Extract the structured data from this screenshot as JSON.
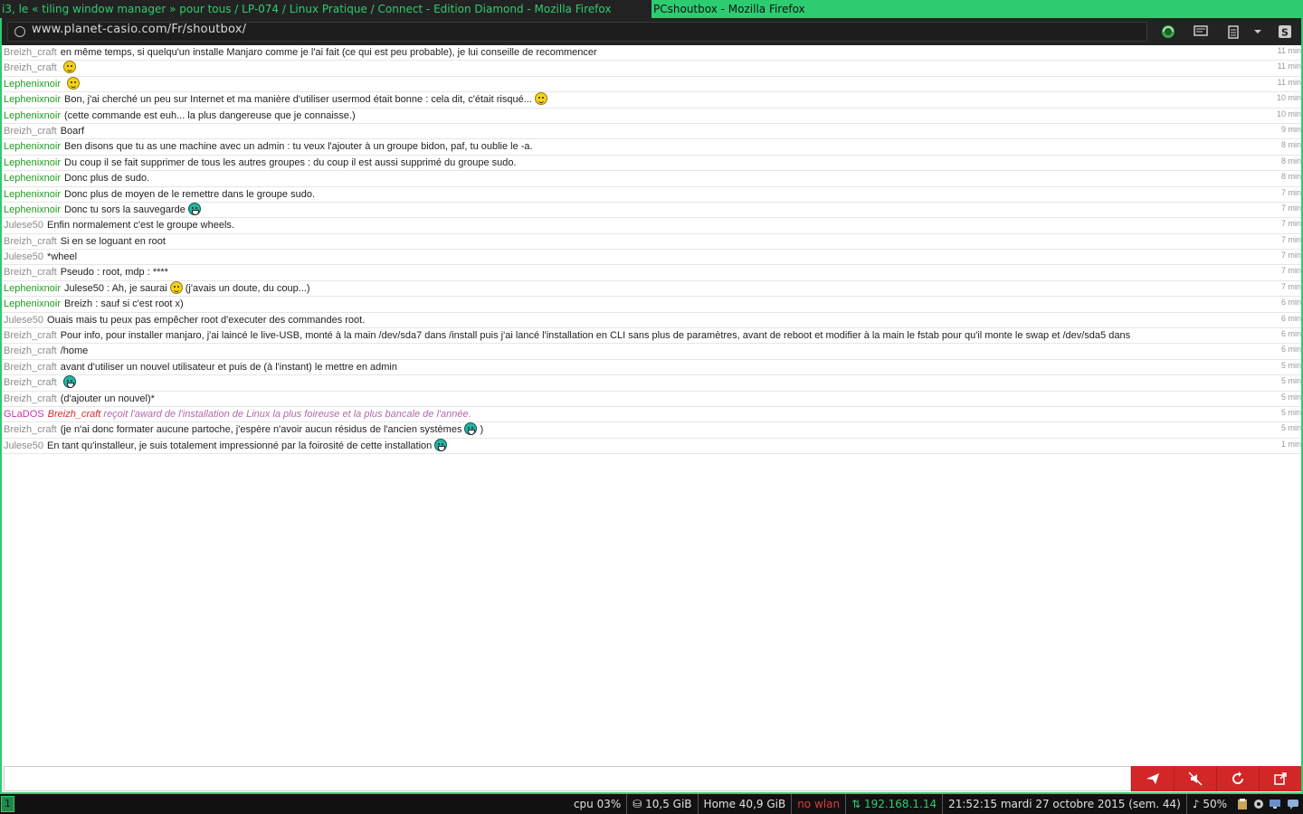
{
  "titlebar": {
    "tabs": [
      {
        "label": "i3, le « tiling window manager » pour tous / LP-074 / Linux Pratique / Connect - Edition Diamond - Mozilla Firefox",
        "active": false
      },
      {
        "label": "PCshoutbox - Mozilla Firefox",
        "active": true
      }
    ]
  },
  "navbar": {
    "url": "www.planet-casio.com/Fr/shoutbox/",
    "icons": [
      "addon-green-icon",
      "reader-icon",
      "clipboard-icon",
      "dropdown-arrow-icon",
      "s-icon"
    ]
  },
  "messages": [
    {
      "author": "Breizh_craft",
      "color": "gray",
      "text": "en même temps, si quelqu'un installe Manjaro comme je l'ai fait (ce qui est peu probable), je lui conseille de recommencer",
      "time": "11 min"
    },
    {
      "author": "Breizh_craft",
      "color": "gray",
      "text": "",
      "smiley": "yellow",
      "time": "11 min"
    },
    {
      "author": "Lephenixnoir",
      "color": "green",
      "text": "",
      "smiley": "yellow",
      "time": "11 min"
    },
    {
      "author": "Lephenixnoir",
      "color": "green",
      "text": "Bon, j'ai cherché un peu sur Internet et ma manière d'utiliser usermod était bonne : cela dit, c'était risqué...",
      "smiley": "yellow",
      "time": "10 min"
    },
    {
      "author": "Lephenixnoir",
      "color": "green",
      "text": "(cette commande est euh... la plus dangereuse que je connaisse.)",
      "time": "10 min"
    },
    {
      "author": "Breizh_craft",
      "color": "gray",
      "text": "Boarf",
      "time": "9 min"
    },
    {
      "author": "Lephenixnoir",
      "color": "green",
      "text": "Ben disons que tu as une machine avec un admin : tu veux l'ajouter à un groupe bidon, paf, tu oublie le -a.",
      "time": "8 min"
    },
    {
      "author": "Lephenixnoir",
      "color": "green",
      "text": "Du coup il se fait supprimer de tous les autres groupes : du coup il est aussi supprimé du groupe sudo.",
      "time": "8 min"
    },
    {
      "author": "Lephenixnoir",
      "color": "green",
      "text": "Donc plus de sudo.",
      "time": "8 min"
    },
    {
      "author": "Lephenixnoir",
      "color": "green",
      "text": "Donc plus de moyen de le remettre dans le groupe sudo.",
      "time": "7 min"
    },
    {
      "author": "Lephenixnoir",
      "color": "green",
      "text": "Donc tu sors la sauvegarde",
      "smiley": "teal",
      "time": "7 min"
    },
    {
      "author": "Julese50",
      "color": "gray",
      "text": "Enfin normalement c'est le groupe wheels.",
      "time": "7 min"
    },
    {
      "author": "Breizh_craft",
      "color": "gray",
      "text": "Si en se loguant en root",
      "time": "7 min"
    },
    {
      "author": "Julese50",
      "color": "gray",
      "text": "*wheel",
      "time": "7 min"
    },
    {
      "author": "Breizh_craft",
      "color": "gray",
      "text": "Pseudo : root, mdp : ****",
      "time": "7 min"
    },
    {
      "author": "Lephenixnoir",
      "color": "green",
      "text": "Julese50 : Ah, je saurai",
      "smiley": "yellow",
      "text_after": "(j'avais un doute, du coup...)",
      "time": "7 min"
    },
    {
      "author": "Lephenixnoir",
      "color": "green",
      "text": "Breizh : sauf si c'est root x)",
      "time": "6 min"
    },
    {
      "author": "Julese50",
      "color": "gray",
      "text": "Ouais mais tu peux pas empêcher root d'executer des commandes root.",
      "time": "6 min"
    },
    {
      "author": "Breizh_craft",
      "color": "gray",
      "text": "Pour info, pour installer manjaro, j'ai laincé le live-USB, monté à la main /dev/sda7 dans /install puis j'ai lancé l'installation en CLI sans plus de paramètres, avant de reboot et modifier à la main le fstab pour qu'il monte le swap et /dev/sda5 dans",
      "time": "6 min"
    },
    {
      "author": "Breizh_craft",
      "color": "gray",
      "text": "/home",
      "time": "6 min"
    },
    {
      "author": "Breizh_craft",
      "color": "gray",
      "text": "avant d'utiliser un nouvel utilisateur et puis de (à l'instant) le mettre en admin",
      "time": "5 min"
    },
    {
      "author": "Breizh_craft",
      "color": "gray",
      "text": "",
      "smiley": "teal",
      "time": "5 min"
    },
    {
      "author": "Breizh_craft",
      "color": "gray",
      "text": "(d'ajouter un nouvel)*",
      "time": "5 min"
    },
    {
      "author": "GLaDOS",
      "color": "pink",
      "system": true,
      "highlight": "Breizh_craft",
      "text": "reçoit l'award de l'installation de Linux la plus foireuse et la plus bancale de l'année.",
      "time": "5 min"
    },
    {
      "author": "Breizh_craft",
      "color": "gray",
      "text": "(je n'ai donc formater aucune partoche, j'espère n'avoir aucun résidus de l'ancien systèmes",
      "smiley": "teal",
      "text_after": ")",
      "time": "5 min"
    },
    {
      "author": "Julese50",
      "color": "gray",
      "text": "En tant qu'installeur, je suis totalement impressionné par la foirosité de cette installation",
      "smiley": "teal",
      "time": "1 min"
    }
  ],
  "input": {
    "value": "",
    "placeholder": ""
  },
  "actions": [
    "send-icon",
    "mute-icon",
    "refresh-icon",
    "external-link-icon"
  ],
  "statusbar": {
    "workspace": "1",
    "items": [
      {
        "text": "cpu  03%",
        "style": ""
      },
      {
        "text": "⛁ 10,5 GiB",
        "style": ""
      },
      {
        "text": "Home 40,9 GiB",
        "style": ""
      },
      {
        "text": "no wlan",
        "style": "red"
      },
      {
        "text": "⇅ 192.168.1.14",
        "style": "green"
      },
      {
        "text": "21:52:15 mardi 27 octobre 2015 (sem. 44)",
        "style": ""
      },
      {
        "text": "♪ 50%",
        "style": "plain"
      }
    ]
  }
}
